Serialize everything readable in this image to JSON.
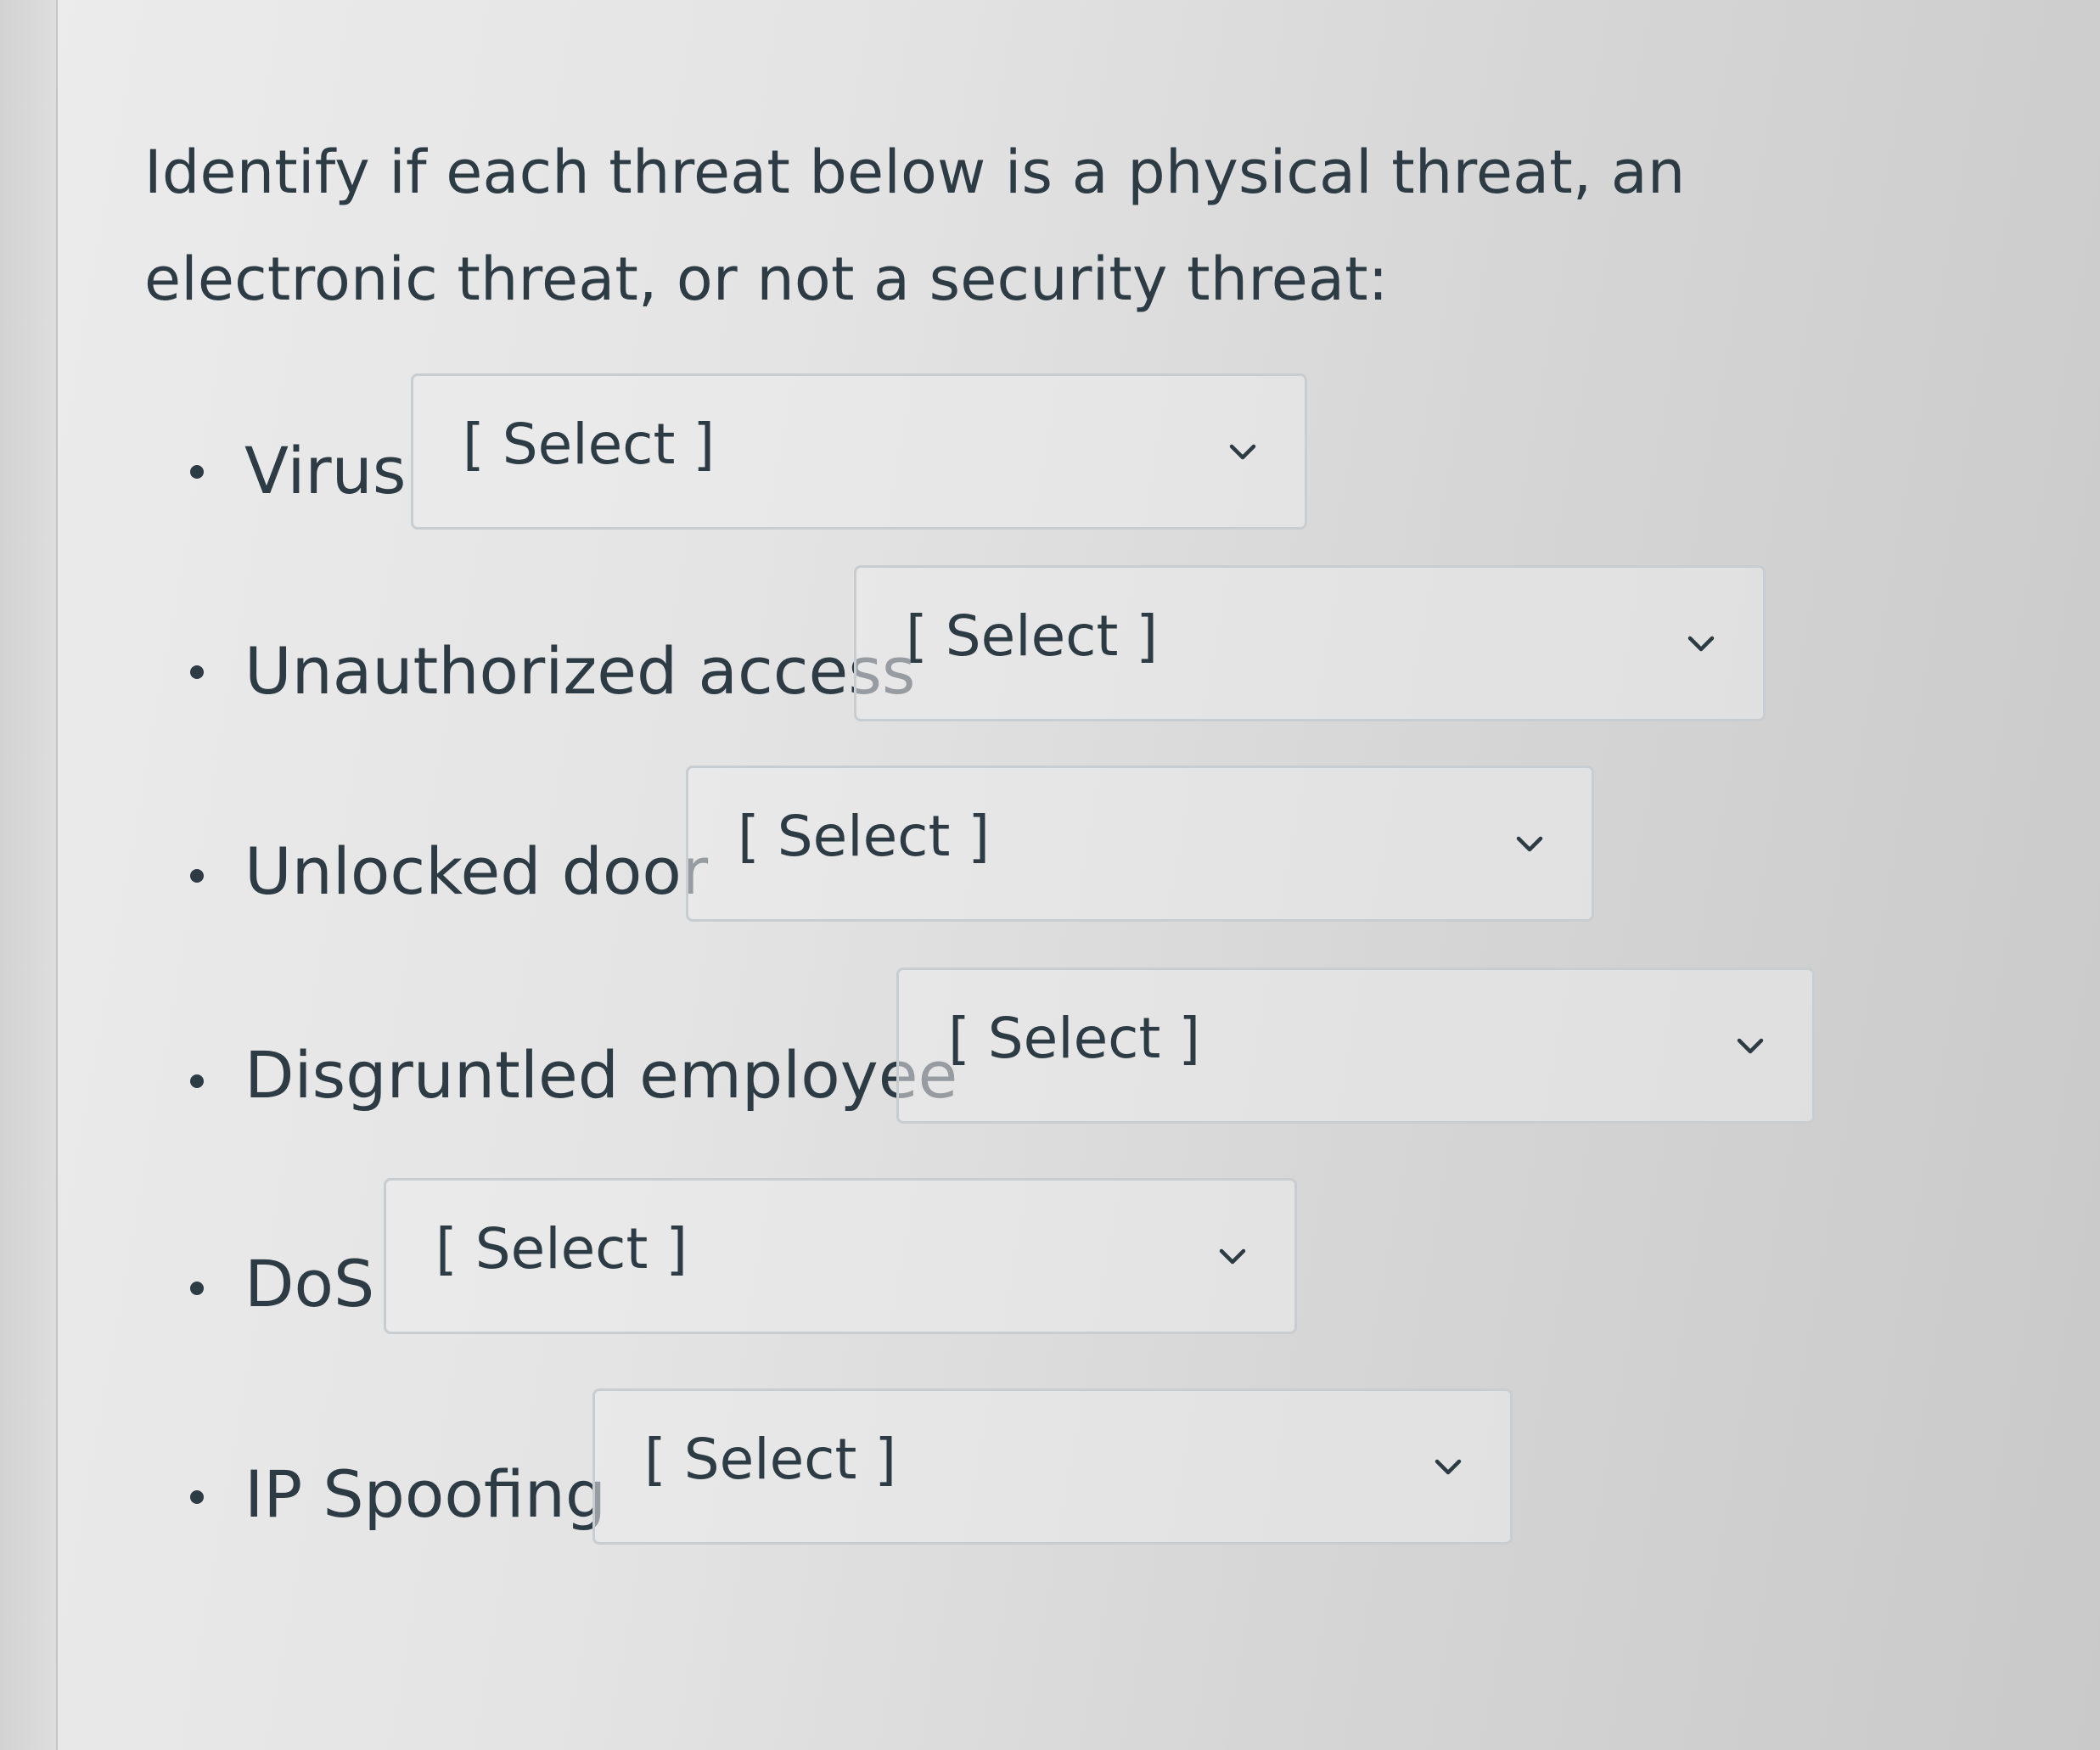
{
  "question": {
    "text": "Identify if each threat below is a physical threat, an electronic threat, or not a security threat:"
  },
  "items": [
    {
      "label": "Virus",
      "selected": "[ Select ]"
    },
    {
      "label": "Unauthorized access",
      "selected": "[ Select ]"
    },
    {
      "label": "Unlocked door",
      "selected": "[ Select ]"
    },
    {
      "label": "Disgruntled employee",
      "selected": "[ Select ]"
    },
    {
      "label": "DoS",
      "selected": "[ Select ]"
    },
    {
      "label": "IP Spoofing",
      "selected": "[ Select ]"
    }
  ],
  "icons": {
    "dropdown": "chevron-down-icon",
    "bullet": "bullet-dot"
  },
  "colors": {
    "text": "#2d3b45",
    "select_border": "#c7cdd1"
  }
}
